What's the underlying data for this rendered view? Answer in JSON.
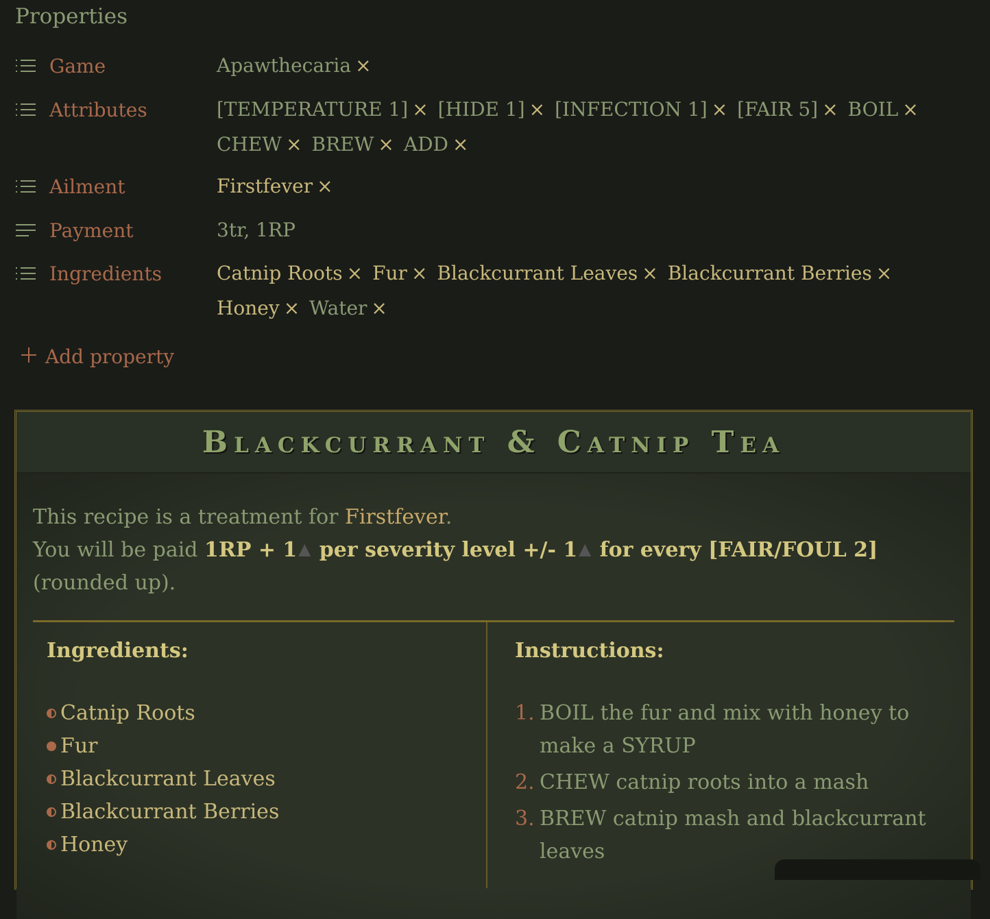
{
  "properties_title": "Properties",
  "properties": [
    {
      "label": "Game",
      "icon": "list-icon",
      "values": [
        {
          "text": "Apawthecaria",
          "tone": "green"
        }
      ]
    },
    {
      "label": "Attributes",
      "icon": "list-icon",
      "values": [
        {
          "text": "[TEMPERATURE 1]",
          "tone": "green"
        },
        {
          "text": "[HIDE 1]",
          "tone": "green"
        },
        {
          "text": "[INFECTION 1]",
          "tone": "green"
        },
        {
          "text": "[FAIR 5]",
          "tone": "green"
        },
        {
          "text": "BOIL",
          "tone": "green"
        },
        {
          "text": "CHEW",
          "tone": "green"
        },
        {
          "text": "BREW",
          "tone": "green"
        },
        {
          "text": "ADD",
          "tone": "green"
        }
      ]
    },
    {
      "label": "Ailment",
      "icon": "list-icon",
      "values": [
        {
          "text": "Firstfever",
          "tone": "yellow"
        }
      ]
    },
    {
      "label": "Payment",
      "icon": "text-icon",
      "text": "3tr, 1RP"
    },
    {
      "label": "Ingredients",
      "icon": "list-icon",
      "values": [
        {
          "text": "Catnip Roots",
          "tone": "yellow"
        },
        {
          "text": "Fur",
          "tone": "yellow"
        },
        {
          "text": "Blackcurrant Leaves",
          "tone": "yellow"
        },
        {
          "text": "Blackcurrant Berries",
          "tone": "yellow"
        },
        {
          "text": "Honey",
          "tone": "yellow"
        },
        {
          "text": "Water",
          "tone": "green"
        }
      ]
    }
  ],
  "remove_symbol": "×",
  "add_property": "Add property",
  "card": {
    "title": "Blackcurrant & Catnip Tea",
    "intro1_prefix": "This recipe is a treatment for ",
    "intro1_ailment": "Firstfever",
    "intro1_suffix": ".",
    "intro2_prefix": "You will be paid ",
    "intro2_b1": "1RP + 1",
    "intro2_b2": " per severity level +/- 1",
    "intro2_b3": " for every [FAIR/FOUL 2]",
    "intro2_suffix": " (rounded up).",
    "ingredients_heading": "Ingredients:",
    "ingredients": [
      "Catnip Roots",
      "Fur",
      "Blackcurrant Leaves",
      "Blackcurrant Berries",
      "Honey"
    ],
    "instructions_heading": "Instructions:",
    "instructions": [
      {
        "num": "1.",
        "text": "BOIL the fur and mix with honey to make a SYRUP"
      },
      {
        "num": "2.",
        "text": "CHEW catnip roots into a mash"
      },
      {
        "num": "3.",
        "text": "BREW catnip mash and blackcurrant leaves"
      }
    ]
  }
}
